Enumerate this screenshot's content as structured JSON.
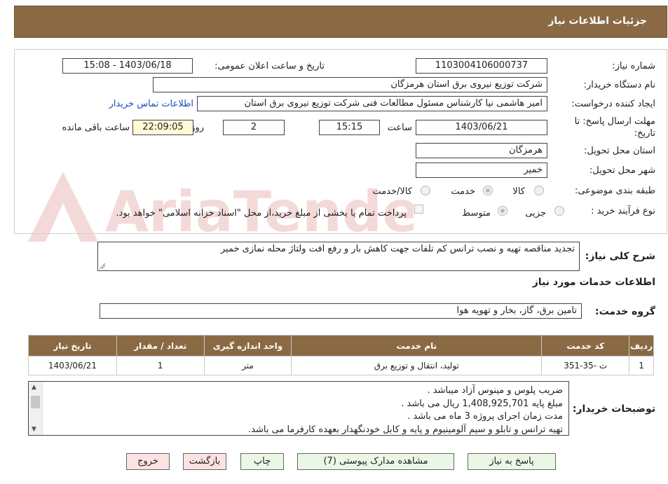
{
  "header": {
    "title": "جزئیات اطلاعات نیاز"
  },
  "fields": {
    "need_number_label": "شماره نیاز:",
    "need_number": "1103004106000737",
    "announce_label": "تاریخ و ساعت اعلان عمومی:",
    "announce_value": "1403/06/18 - 15:08",
    "buyer_org_label": "نام دستگاه خریدار:",
    "buyer_org": "شرکت توزیع نیروی برق استان هرمزگان",
    "requester_label": "ایجاد کننده درخواست:",
    "requester": "امیر هاشمی نیا کارشناس مسئول مطالعات فنی شرکت توزیع نیروی برق استان",
    "contact_link": "اطلاعات تماس خریدار",
    "deadline_label": "مهلت ارسال پاسخ: تا تاریخ:",
    "deadline_date": "1403/06/21",
    "time_label": "ساعت",
    "deadline_time": "15:15",
    "days_value": "2",
    "days_label": "روز و",
    "remaining_time": "22:09:05",
    "remaining_label": "ساعت باقی مانده",
    "province_label": "استان محل تحویل:",
    "province": "هرمزگان",
    "city_label": "شهر محل تحویل:",
    "city": "خمیر",
    "category_label": "طبقه بندی موضوعی:",
    "category_options": [
      "کالا",
      "خدمت",
      "کالا/خدمت"
    ],
    "category_selected": "خدمت",
    "process_label": "نوع فرآیند خرید :",
    "process_options": [
      "جزیی",
      "متوسط"
    ],
    "process_selected": "متوسط",
    "payment_note": "پرداخت تمام یا بخشی از مبلغ خرید،از محل \"اسناد خزانه اسلامی\" خواهد بود."
  },
  "summary": {
    "label": "شرح کلی نیاز:",
    "text": "تجدید مناقصه تهیه و نصب ترانس کم تلفات جهت کاهش بار و رفع افت ولتاژ محله نمازی خمیر"
  },
  "services": {
    "section_title": "اطلاعات خدمات مورد نیاز",
    "group_label": "گروه خدمت:",
    "group_value": "تامین برق، گاز، بخار و تهویه هوا",
    "columns": [
      "ردیف",
      "کد خدمت",
      "نام خدمت",
      "واحد اندازه گیری",
      "تعداد / مقدار",
      "تاریخ نیاز"
    ],
    "rows": [
      [
        "1",
        "ت -35-351",
        "تولید، انتقال و توزیع برق",
        "متر",
        "1",
        "1403/06/21"
      ]
    ]
  },
  "notes": {
    "label": "توضیحات خریدار:",
    "lines": [
      "ضریب پلوس و مینوس آزاد میباشد .",
      "مبلغ پایه 1,408,925,701 ریال می باشد .",
      "مدت زمان اجرای پروژه 3 ماه می باشد .",
      "تهیه ترانس و تابلو و سیم آلومینیوم و پایه و کابل خودنگهدار بعهده کارفرما می باشد."
    ]
  },
  "buttons": {
    "reply": "پاسخ به نیاز",
    "attachments": "مشاهده مدارک پیوستی (7)",
    "print": "چاپ",
    "back": "بازگشت",
    "exit": "خروج"
  },
  "watermark": {
    "text": "AriaTender.neT"
  },
  "colors": {
    "header_bg": "#8a6a44",
    "link": "#1a4fc0",
    "button_green": "#eaf7e4",
    "button_red": "#fde2e2",
    "highlight": "#fffbd6"
  }
}
